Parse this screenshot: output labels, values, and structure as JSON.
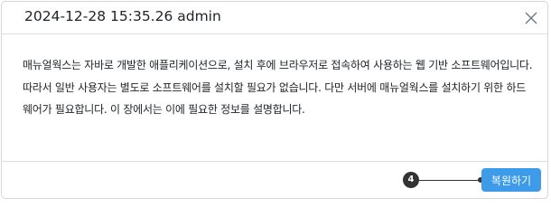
{
  "dialog": {
    "title": "2024-12-28 15:35.26  admin",
    "close_icon": "close-icon",
    "body_text": "매뉴얼웍스는 자바로 개발한 애플리케이션으로, 설치 후에 브라우저로 접속하여 사용하는 웹 기반 소프트웨어입니다. 따라서 일반 사용자는 별도로 소프트웨어를 설치할 필요가 없습니다. 다만 서버에 매뉴얼웍스를 설치하기 위한 하드웨어가 필요합니다. 이 장에서는 이에 필요한 정보를 설명합니다.",
    "restore_label": "복원하기"
  },
  "annotation": {
    "step_number": "4"
  },
  "colors": {
    "accent": "#3d9be9",
    "badge": "#333333",
    "border": "#dedede"
  }
}
